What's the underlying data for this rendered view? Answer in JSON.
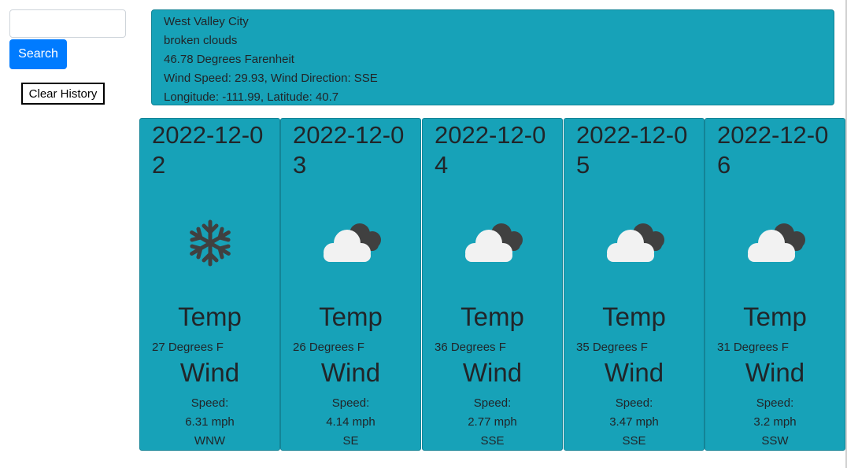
{
  "sidebar": {
    "search_value": "",
    "search_button": "Search",
    "clear_button": "Clear History"
  },
  "current": {
    "city": "West Valley City",
    "description": "broken clouds",
    "temperature": "46.78 Degrees Farenheit",
    "wind": "Wind Speed: 29.93, Wind Direction: SSE",
    "coords": "Longitude: -111.99, Latitude: 40.7"
  },
  "forecast": [
    {
      "date": "2022-12-02",
      "icon": "snowflake-icon",
      "temp_label": "Temp",
      "temp": "27 Degrees F",
      "wind_label": "Wind",
      "speed_label": "Speed:",
      "speed": "6.31 mph",
      "direction": "WNW"
    },
    {
      "date": "2022-12-03",
      "icon": "broken-clouds-icon",
      "temp_label": "Temp",
      "temp": "26 Degrees F",
      "wind_label": "Wind",
      "speed_label": "Speed:",
      "speed": "4.14 mph",
      "direction": "SE"
    },
    {
      "date": "2022-12-04",
      "icon": "broken-clouds-icon",
      "temp_label": "Temp",
      "temp": "36 Degrees F",
      "wind_label": "Wind",
      "speed_label": "Speed:",
      "speed": "2.77 mph",
      "direction": "SSE"
    },
    {
      "date": "2022-12-05",
      "icon": "broken-clouds-icon",
      "temp_label": "Temp",
      "temp": "35 Degrees F",
      "wind_label": "Wind",
      "speed_label": "Speed:",
      "speed": "3.47 mph",
      "direction": "SSE"
    },
    {
      "date": "2022-12-06",
      "icon": "broken-clouds-icon",
      "temp_label": "Temp",
      "temp": "31 Degrees F",
      "wind_label": "Wind",
      "speed_label": "Speed:",
      "speed": "3.2 mph",
      "direction": "SSW"
    }
  ],
  "colors": {
    "accent": "#17a2b8",
    "button": "#007bff"
  }
}
